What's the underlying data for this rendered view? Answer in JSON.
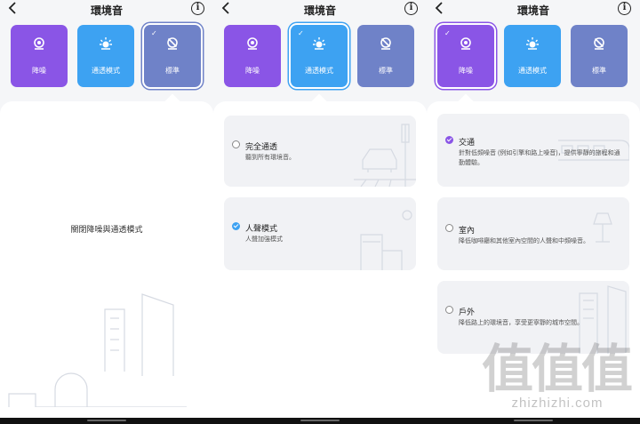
{
  "app": {
    "title": "環境音"
  },
  "modes": [
    "降噪",
    "通透模式",
    "標準"
  ],
  "screen1": {
    "center_text": "關閉降噪與通透模式"
  },
  "screen2": {
    "options": [
      {
        "title": "完全通透",
        "desc": "聽到所有環境音。"
      },
      {
        "title": "人聲模式",
        "desc": "人聲加強模式"
      }
    ]
  },
  "screen3": {
    "options": [
      {
        "title": "交通",
        "desc": "針對低頻噪音 (例如引擎和路上噪音)，提供寧靜的旅程和通勤體驗。"
      },
      {
        "title": "室內",
        "desc": "降低咖啡廳和其他室內空間的人聲和中頻噪音。"
      },
      {
        "title": "戶外",
        "desc": "降低路上的環境音，享受更寧靜的城市空間。"
      }
    ]
  },
  "watermark": {
    "glyphs": "值值值",
    "url": "zhizhizhi.com"
  },
  "colors": {
    "noise_cancel": "#8a55e6",
    "transparency": "#3da2f2",
    "standard": "#6f82c8"
  },
  "icons": {
    "noise_cancel": "headset-icon",
    "transparency": "sun-icon",
    "standard": "off-icon",
    "checked": "check-icon"
  }
}
